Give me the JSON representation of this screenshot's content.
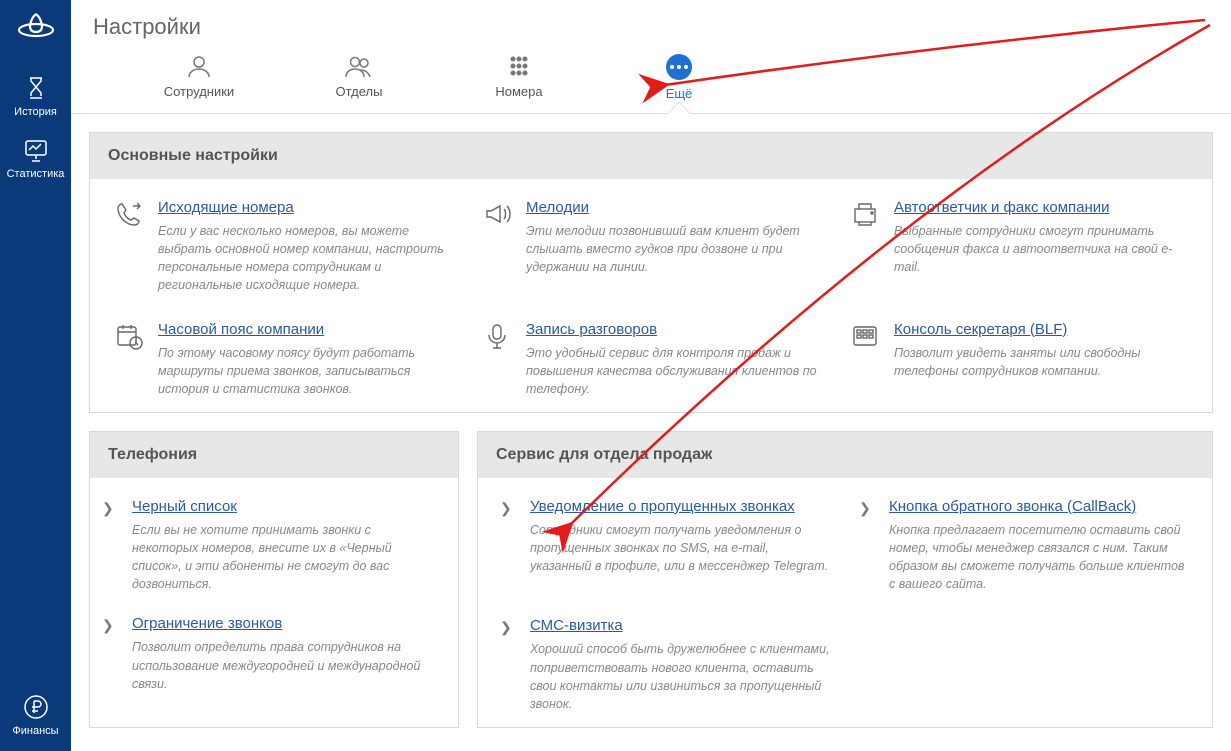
{
  "sidebar": {
    "items": [
      {
        "label": "История"
      },
      {
        "label": "Статистика"
      }
    ],
    "bottom": {
      "label": "Финансы"
    }
  },
  "page_title": "Настройки",
  "tabs": [
    {
      "label": "Сотрудники"
    },
    {
      "label": "Отделы"
    },
    {
      "label": "Номера"
    },
    {
      "label": "Ещё"
    }
  ],
  "panels": {
    "main": {
      "title": "Основные настройки",
      "items": [
        {
          "title": "Исходящие номера",
          "desc": "Если у вас несколько номеров, вы можете выбрать основной номер компании, настроить персональные номера сотрудникам и региональные исходящие номера."
        },
        {
          "title": "Мелодии",
          "desc": "Эти мелодии позвонивший вам клиент будет слышать вместо гудков при дозвоне и при удержании на линии."
        },
        {
          "title": "Автоответчик и факс компании",
          "desc": "Выбранные сотрудники смогут принимать сообщения факса и автоответчика на свой e-mail."
        },
        {
          "title": "Часовой пояс компании",
          "desc": "По этому часовому поясу будут работать маршруты приема звонков, записываться история и статистика звонков."
        },
        {
          "title": "Запись разговоров",
          "desc": "Это удобный сервис для контроля продаж и повышения качества обслуживания клиентов по телефону."
        },
        {
          "title": "Консоль секретаря (BLF)",
          "desc": "Позволит увидеть заняты или свободны телефоны сотрудников компании."
        }
      ]
    },
    "telephony": {
      "title": "Телефония",
      "items": [
        {
          "title": "Черный список",
          "desc": "Если вы не хотите принимать звонки с некоторых номеров, внесите их в «Черный список»,\nи эти абоненты не смогут до вас дозвониться."
        },
        {
          "title": "Ограничение звонков",
          "desc": "Позволит определить права сотрудников на использование междугородней и международной связи."
        }
      ]
    },
    "sales": {
      "title": "Сервис для отдела продаж",
      "items": [
        {
          "title": "Уведомление о пропущенных звонках",
          "desc": "Сотрудники смогут получать уведомления о пропущенных звонках по SMS, на e-mail, указанный в профиле, или в мессенджер Telegram."
        },
        {
          "title": "Кнопка обратного звонка (CallBack)",
          "desc": "Кнопка предлагает посетителю оставить свой номер, чтобы менеджер связался с ним. Таким образом вы сможете получать больше клиентов с вашего сайта."
        },
        {
          "title": "СМС-визитка",
          "desc": "Хороший способ быть дружелюбнее с клиентами, поприветствовать нового клиента, оставить свои контакты или извиниться за пропущенный звонок."
        }
      ]
    }
  }
}
